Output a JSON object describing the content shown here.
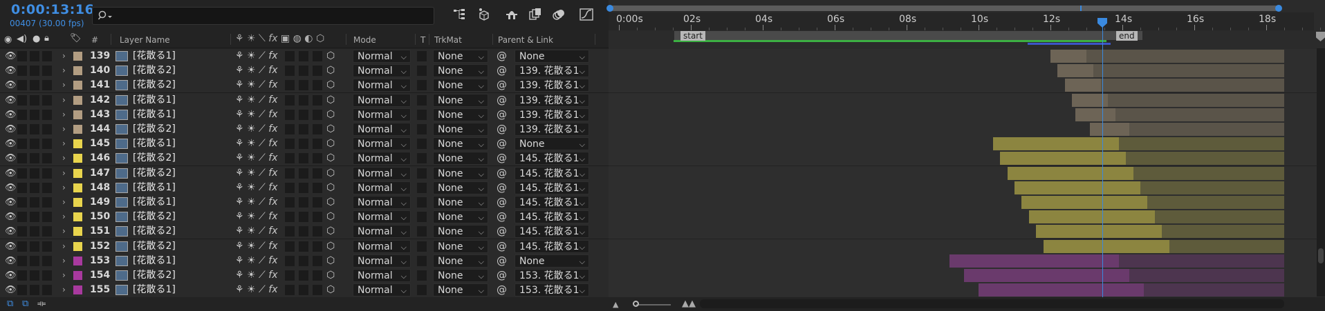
{
  "header": {
    "timecode": "0:00:13:16",
    "frames": "00407 (30.00 fps)",
    "search_placeholder": "",
    "search_icon": "search-icon"
  },
  "toolbar_icons": [
    "composition-flowchart-icon",
    "draft-3d-icon",
    "shy-layers-icon",
    "frame-blending-icon",
    "motion-blur-icon",
    "graph-editor-icon"
  ],
  "columns": {
    "label_col": "",
    "num_col": "#",
    "layer_name": "Layer Name",
    "mode": "Mode",
    "t": "T",
    "trkmat": "TrkMat",
    "parent": "Parent & Link"
  },
  "ruler": {
    "labels": [
      "0:00s",
      "02s",
      "04s",
      "06s",
      "08s",
      "10s",
      "12s",
      "14s",
      "16s",
      "18s"
    ],
    "marker_start": "start",
    "marker_end": "end"
  },
  "layers": [
    {
      "num": "139",
      "name": "[花散る1]",
      "mode": "Normal",
      "trkmat": "None",
      "parent": "None",
      "color": "#b29d82",
      "bar_start": 12.0,
      "bar_end": 13.0,
      "bar_end2": 18.5
    },
    {
      "num": "140",
      "name": "[花散る2]",
      "mode": "Normal",
      "trkmat": "None",
      "parent": "139. 花散る1",
      "color": "#b29d82",
      "bar_start": 12.2,
      "bar_end": 13.2,
      "bar_end2": 18.5
    },
    {
      "num": "141",
      "name": "[花散る2]",
      "mode": "Normal",
      "trkmat": "None",
      "parent": "139. 花散る1",
      "color": "#b29d82",
      "bar_start": 12.4,
      "bar_end": 13.4,
      "bar_end2": 18.5
    },
    {
      "num": "142",
      "name": "[花散る1]",
      "mode": "Normal",
      "trkmat": "None",
      "parent": "139. 花散る1",
      "color": "#b29d82",
      "bar_start": 12.6,
      "bar_end": 13.6,
      "bar_end2": 18.5
    },
    {
      "num": "143",
      "name": "[花散る1]",
      "mode": "Normal",
      "trkmat": "None",
      "parent": "139. 花散る1",
      "color": "#b29d82",
      "bar_start": 12.7,
      "bar_end": 13.8,
      "bar_end2": 18.5
    },
    {
      "num": "144",
      "name": "[花散る2]",
      "mode": "Normal",
      "trkmat": "None",
      "parent": "139. 花散る1",
      "color": "#b29d82",
      "bar_start": 13.1,
      "bar_end": 14.2,
      "bar_end2": 18.5
    },
    {
      "num": "145",
      "name": "[花散る1]",
      "mode": "Normal",
      "trkmat": "None",
      "parent": "None",
      "color": "#e8d44d",
      "bar_start": 10.4,
      "bar_end": 13.9,
      "bar_end2": 18.5
    },
    {
      "num": "146",
      "name": "[花散る2]",
      "mode": "Normal",
      "trkmat": "None",
      "parent": "145. 花散る1",
      "color": "#e8d44d",
      "bar_start": 10.6,
      "bar_end": 14.1,
      "bar_end2": 18.5
    },
    {
      "num": "147",
      "name": "[花散る2]",
      "mode": "Normal",
      "trkmat": "None",
      "parent": "145. 花散る1",
      "color": "#e8d44d",
      "bar_start": 10.8,
      "bar_end": 14.3,
      "bar_end2": 18.5
    },
    {
      "num": "148",
      "name": "[花散る1]",
      "mode": "Normal",
      "trkmat": "None",
      "parent": "145. 花散る1",
      "color": "#e8d44d",
      "bar_start": 11.0,
      "bar_end": 14.5,
      "bar_end2": 18.5
    },
    {
      "num": "149",
      "name": "[花散る1]",
      "mode": "Normal",
      "trkmat": "None",
      "parent": "145. 花散る1",
      "color": "#e8d44d",
      "bar_start": 11.2,
      "bar_end": 14.7,
      "bar_end2": 18.5
    },
    {
      "num": "150",
      "name": "[花散る2]",
      "mode": "Normal",
      "trkmat": "None",
      "parent": "145. 花散る1",
      "color": "#e8d44d",
      "bar_start": 11.4,
      "bar_end": 14.9,
      "bar_end2": 18.5
    },
    {
      "num": "151",
      "name": "[花散る2]",
      "mode": "Normal",
      "trkmat": "None",
      "parent": "145. 花散る1",
      "color": "#e8d44d",
      "bar_start": 11.6,
      "bar_end": 15.1,
      "bar_end2": 18.5
    },
    {
      "num": "152",
      "name": "[花散る2]",
      "mode": "Normal",
      "trkmat": "None",
      "parent": "145. 花散る1",
      "color": "#e8d44d",
      "bar_start": 11.8,
      "bar_end": 15.3,
      "bar_end2": 18.5
    },
    {
      "num": "153",
      "name": "[花散る1]",
      "mode": "Normal",
      "trkmat": "None",
      "parent": "None",
      "color": "#a8399e",
      "bar_start": 9.2,
      "bar_end": 13.9,
      "bar_end2": 18.5
    },
    {
      "num": "154",
      "name": "[花散る2]",
      "mode": "Normal",
      "trkmat": "None",
      "parent": "153. 花散る1",
      "color": "#a8399e",
      "bar_start": 9.6,
      "bar_end": 14.2,
      "bar_end2": 18.5
    },
    {
      "num": "155",
      "name": "[花散る1]",
      "mode": "Normal",
      "trkmat": "None",
      "parent": "153. 花散る1",
      "color": "#a8399e",
      "bar_start": 10.0,
      "bar_end": 14.6,
      "bar_end2": 18.5
    }
  ],
  "bar_colors": {
    "#b29d82": [
      "#6d6456",
      "#5a5449"
    ],
    "#e8d44d": [
      "#8c8540",
      "#5e5b3b"
    ],
    "#a8399e": [
      "#6a3a6c",
      "#4d354f"
    ]
  },
  "current_time_sec": 13.53
}
